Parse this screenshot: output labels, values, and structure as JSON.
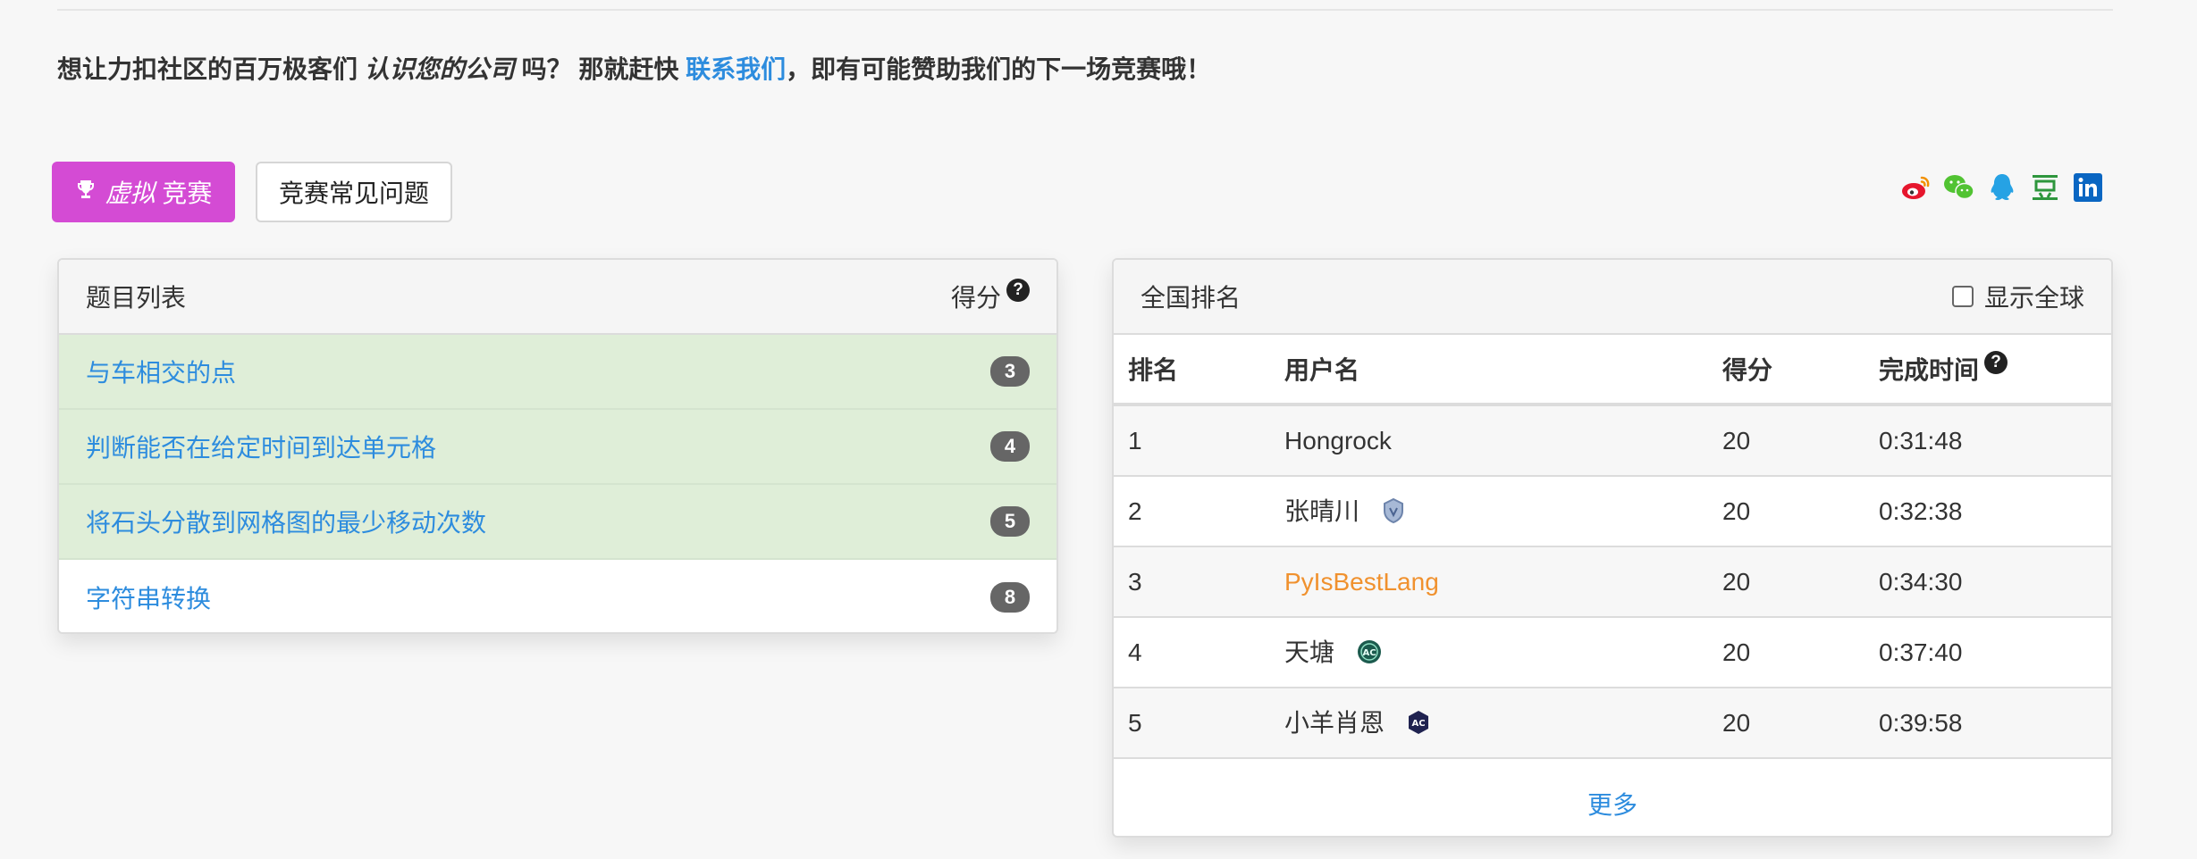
{
  "promo": {
    "text_before": "想让力扣社区的百万极客们",
    "emphasis": "认识您的公司",
    "text_middle": "吗？ 那就赶快",
    "link": "联系我们",
    "text_after": "，即有可能赞助我们的下一场竞赛哦！"
  },
  "actions": {
    "virtual_em": "虚拟",
    "virtual_label": "竞赛",
    "faq_label": "竞赛常见问题"
  },
  "social_icons": [
    "weibo-icon",
    "wechat-icon",
    "qq-icon",
    "douban-icon",
    "linkedin-icon"
  ],
  "problems": {
    "title": "题目列表",
    "score_header": "得分",
    "help": "?",
    "items": [
      {
        "name": "与车相交的点",
        "score": "3",
        "solved": true
      },
      {
        "name": "判断能否在给定时间到达单元格",
        "score": "4",
        "solved": true
      },
      {
        "name": "将石头分散到网格图的最少移动次数",
        "score": "5",
        "solved": true
      },
      {
        "name": "字符串转换",
        "score": "8",
        "solved": false
      }
    ]
  },
  "ranking": {
    "title": "全国排名",
    "show_global": "显示全球",
    "columns": {
      "rank": "排名",
      "user": "用户名",
      "score": "得分",
      "time": "完成时间"
    },
    "help": "?",
    "rows": [
      {
        "rank": "1",
        "user": "Hongrock",
        "score": "20",
        "time": "0:31:48",
        "badge": ""
      },
      {
        "rank": "2",
        "user": "张晴川",
        "score": "20",
        "time": "0:32:38",
        "badge": "guardian-badge-icon"
      },
      {
        "rank": "3",
        "user": "PyIsBestLang",
        "score": "20",
        "time": "0:34:30",
        "badge": "",
        "highlight": true
      },
      {
        "rank": "4",
        "user": "天塘",
        "score": "20",
        "time": "0:37:40",
        "badge": "ac-badge-icon"
      },
      {
        "rank": "5",
        "user": "小羊肖恩",
        "score": "20",
        "time": "0:39:58",
        "badge": "ac-badge-icon"
      }
    ],
    "more": "更多"
  },
  "colors": {
    "accent_purple": "#d44bd4",
    "link_blue": "#2d8cde",
    "solved_green": "#dfeed8",
    "highlight_orange": "#f0912e"
  }
}
